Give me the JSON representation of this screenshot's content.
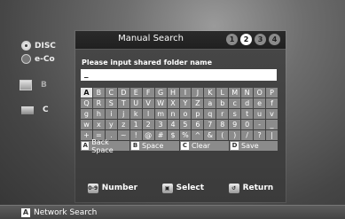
{
  "background_menu": {
    "items": [
      {
        "label": "DISC",
        "icon": "disc-icon"
      },
      {
        "label": "e-Co",
        "icon": "globe-icon"
      },
      {
        "label": "B",
        "icon": "pc-icon"
      },
      {
        "label": "C",
        "icon": "network-storage-icon"
      }
    ]
  },
  "dialog": {
    "title": "Manual Search",
    "steps": [
      "1",
      "2",
      "3",
      "4"
    ],
    "active_step": "2",
    "prompt": "Please input shared folder name",
    "input_value": "_",
    "keyboard_rows": [
      [
        "A",
        "B",
        "C",
        "D",
        "E",
        "F",
        "G",
        "H",
        "I",
        "J",
        "K",
        "L",
        "M",
        "N",
        "O",
        "P"
      ],
      [
        "Q",
        "R",
        "S",
        "T",
        "U",
        "V",
        "W",
        "X",
        "Y",
        "Z",
        "a",
        "b",
        "c",
        "d",
        "e",
        "f"
      ],
      [
        "g",
        "h",
        "i",
        "j",
        "k",
        "l",
        "m",
        "n",
        "o",
        "p",
        "q",
        "r",
        "s",
        "t",
        "u",
        "v"
      ],
      [
        "w",
        "x",
        "y",
        "z",
        "1",
        "2",
        "3",
        "4",
        "5",
        "6",
        "7",
        "8",
        "9",
        "0",
        "-",
        "_"
      ],
      [
        "+",
        "=",
        ".",
        "~",
        "!",
        "@",
        "#",
        "$",
        "%",
        "^",
        "&",
        "(",
        ")",
        "/",
        "?",
        "|"
      ]
    ],
    "selected_key": "A",
    "function_keys": [
      {
        "badge": "A",
        "label": "Back Space"
      },
      {
        "badge": "B",
        "label": "Space"
      },
      {
        "badge": "C",
        "label": "Clear"
      },
      {
        "badge": "D",
        "label": "Save"
      }
    ],
    "bottom_buttons": [
      {
        "icon": "0-9",
        "label": "Number"
      },
      {
        "icon": "select-icon",
        "label": "Select"
      },
      {
        "icon": "return-icon",
        "label": "Return"
      }
    ]
  },
  "footer": {
    "badge": "A",
    "label": "Network Search"
  }
}
